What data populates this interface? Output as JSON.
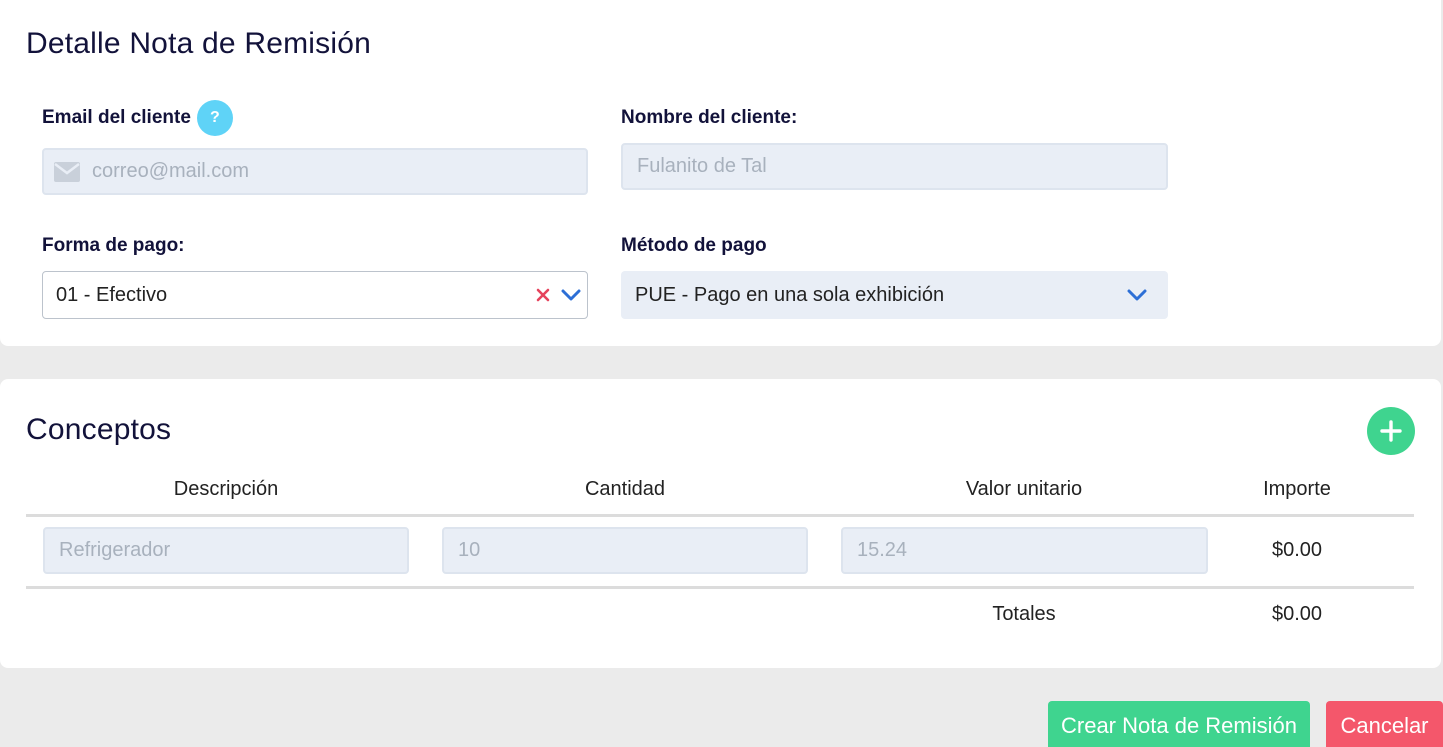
{
  "header": {
    "title": "Detalle Nota de Remisión"
  },
  "client": {
    "email_label": "Email del cliente",
    "help_glyph": "?",
    "email_placeholder": "correo@mail.com",
    "name_label": "Nombre del cliente:",
    "name_placeholder": "Fulanito de Tal"
  },
  "payment": {
    "forma_label": "Forma de pago:",
    "forma_value": "01 - Efectivo",
    "metodo_label": "Método de pago",
    "metodo_value": "PUE - Pago en una sola exhibición"
  },
  "concepts": {
    "title": "Conceptos",
    "columns": [
      "Descripción",
      "Cantidad",
      "Valor unitario",
      "Importe"
    ],
    "rows": [
      {
        "descripcion": "Refrigerador",
        "cantidad": "10",
        "valor_unitario": "15.24",
        "importe": "$0.00"
      }
    ],
    "totals_label": "Totales",
    "totals_value": "$0.00"
  },
  "actions": {
    "create_label": "Crear Nota de Remisión",
    "cancel_label": "Cancelar"
  },
  "colors": {
    "accent_green": "#3fd48f",
    "cancel_red": "#f4576b",
    "help_blue": "#5fd3f7",
    "chevron_blue": "#2d6fd6",
    "clear_red": "#e5435c"
  }
}
